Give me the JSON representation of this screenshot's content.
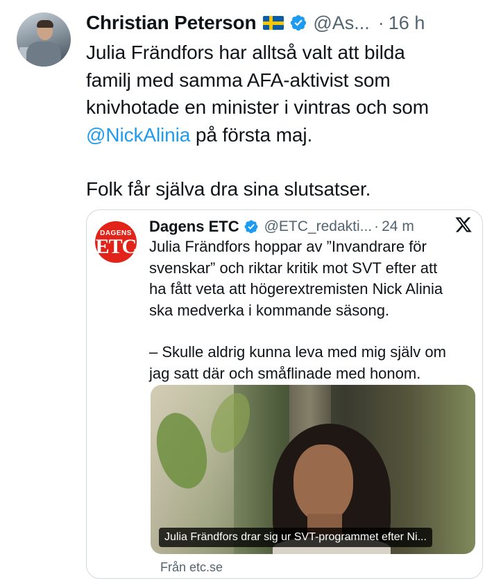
{
  "tweet": {
    "author_name": "Christian Peterson",
    "author_flag": "swedish-flag",
    "author_handle": "@As...",
    "separator": "·",
    "time": "16 h",
    "text_lines": [
      "Julia Frändfors har alltså valt att bilda",
      "familj med samma AFA-aktivist som",
      "knivhotade en minister i vintras och som"
    ],
    "line4_mention": "@NickAlinia",
    "line4_rest": " på första maj.",
    "line5": "Folk får själva dra sina slutsatser."
  },
  "quote": {
    "logo_top": "DAGENS",
    "logo_main": "ETC",
    "name": "Dagens ETC",
    "handle": "@ETC_redakti...",
    "separator": "·",
    "time": "24 m",
    "text_lines": [
      "Julia Frändfors hoppar av ”Invandrare för",
      "svenskar” och riktar kritik mot SVT efter att",
      "ha fått veta att högerextremisten Nick Alinia",
      "ska medverka i kommande säsong."
    ],
    "text_lines_2": [
      "– Skulle aldrig kunna leva med mig själv om",
      "jag satt där och småflinade med honom."
    ],
    "image_caption": "Julia Frändfors drar sig ur SVT-programmet efter Ni...",
    "link_source": "Från etc.se"
  },
  "colors": {
    "link": "#1d9bf0",
    "secondary_text": "#536471",
    "verified_blue": "#1d9bf0",
    "etc_red": "#e2231a",
    "border": "#cfd9de"
  },
  "icons": {
    "verified": "verified-badge-icon",
    "platform": "x-logo-icon"
  }
}
